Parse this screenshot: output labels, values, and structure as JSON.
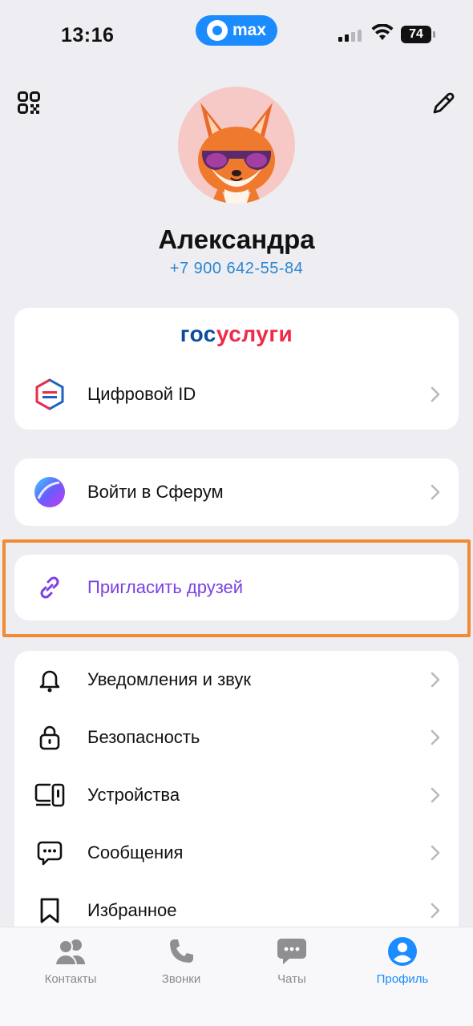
{
  "status_bar": {
    "time": "13:16",
    "app_pill": "max",
    "battery": "74"
  },
  "profile": {
    "name": "Александра",
    "phone": "+7 900 642-55-84"
  },
  "gosuslugi": {
    "title_part1": "гос",
    "title_part2": "услуги",
    "item_label": "Цифровой ID"
  },
  "sferum": {
    "label": "Войти в Сферум"
  },
  "invite": {
    "label": "Пригласить друзей"
  },
  "settings": {
    "items": [
      {
        "label": "Уведомления и звук",
        "icon": "bell-icon"
      },
      {
        "label": "Безопасность",
        "icon": "lock-icon"
      },
      {
        "label": "Устройства",
        "icon": "devices-icon"
      },
      {
        "label": "Сообщения",
        "icon": "message-icon"
      },
      {
        "label": "Избранное",
        "icon": "bookmark-icon"
      }
    ]
  },
  "tabbar": {
    "tabs": [
      {
        "label": "Контакты",
        "icon": "contacts-icon"
      },
      {
        "label": "Звонки",
        "icon": "phone-icon"
      },
      {
        "label": "Чаты",
        "icon": "chat-icon"
      },
      {
        "label": "Профиль",
        "icon": "profile-icon",
        "active": true
      }
    ]
  },
  "colors": {
    "accent": "#1a8cff",
    "invite_purple": "#7b3fe4",
    "highlight_outline": "#f08a34"
  }
}
